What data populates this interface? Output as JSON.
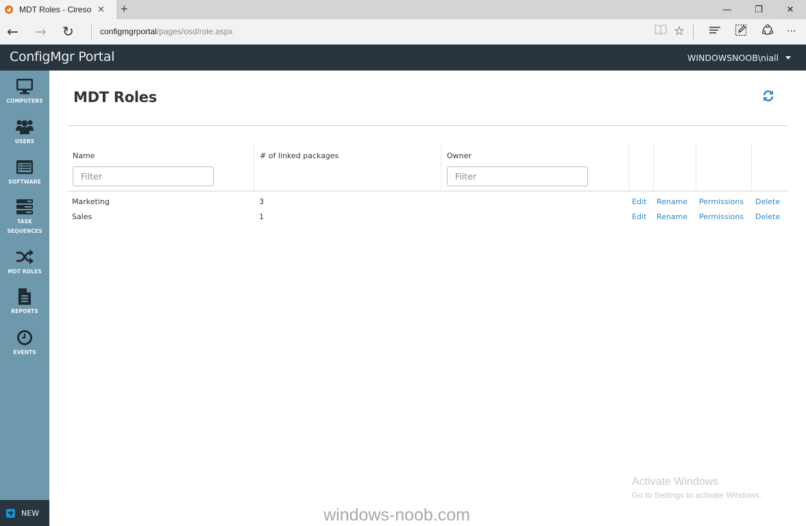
{
  "browser": {
    "tab_title": "MDT Roles - Cireson CM",
    "new_tab": "+",
    "address_host": "configmgrportal",
    "address_path": "/pages/osd/role.aspx",
    "win_minimize": "—",
    "win_restore": "❐",
    "win_close": "✕",
    "back": "←",
    "forward": "→",
    "refresh": "↻",
    "tab_close": "✕",
    "tool_reading": "📖",
    "tool_favorite": "☆",
    "tool_hub": "≡",
    "tool_note": "✎",
    "tool_share": "⟁",
    "tool_more": "···"
  },
  "app": {
    "brand": "ConfigMgr Portal",
    "user": "WINDOWSNOOB\\niall"
  },
  "sidebar": {
    "items": [
      {
        "label": "COMPUTERS",
        "icon": "monitor-icon"
      },
      {
        "label": "USERS",
        "icon": "users-icon"
      },
      {
        "label": "SOFTWARE",
        "icon": "software-icon"
      },
      {
        "label": "TASK SEQUENCES",
        "icon": "task-sequences-icon"
      },
      {
        "label": "MDT ROLES",
        "icon": "shuffle-icon"
      },
      {
        "label": "REPORTS",
        "icon": "document-icon"
      },
      {
        "label": "EVENTS",
        "icon": "clock-icon"
      }
    ],
    "new_label": "NEW"
  },
  "page": {
    "title": "MDT Roles",
    "refresh_icon": "refresh-icon"
  },
  "grid": {
    "columns": [
      {
        "label": "Name",
        "filter_placeholder": "Filter"
      },
      {
        "label": "# of linked packages"
      },
      {
        "label": "Owner",
        "filter_placeholder": "Filter"
      }
    ],
    "rows": [
      {
        "name": "Marketing",
        "linked": "3",
        "owner": "",
        "actions": [
          "Edit",
          "Rename",
          "Permissions",
          "Delete"
        ]
      },
      {
        "name": "Sales",
        "linked": "1",
        "owner": "",
        "actions": [
          "Edit",
          "Rename",
          "Permissions",
          "Delete"
        ]
      }
    ]
  },
  "overlay": {
    "activate_title": "Activate Windows",
    "activate_sub": "Go to Settings to activate Windows.",
    "site": "windows-noob.com"
  },
  "colors": {
    "header_bg": "#28353e",
    "sidebar_bg": "#6e98ab",
    "link": "#2d87c6",
    "accent": "#1b8fd4"
  }
}
